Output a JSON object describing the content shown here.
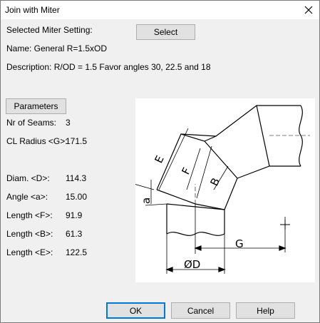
{
  "window": {
    "title": "Join with Miter"
  },
  "selected": {
    "label": "Selected Miter Setting:",
    "select_button": "Select",
    "name": "Name: General R=1.5xOD",
    "description": "Description: R/OD = 1.5 Favor angles 30, 22.5 and 18"
  },
  "parameters": {
    "button": "Parameters",
    "rows": [
      {
        "label": "Nr of Seams:",
        "value": "3"
      },
      {
        "label": "CL Radius <G>:",
        "value": "171.5"
      },
      {
        "label": "Diam. <D>:",
        "value": "114.3"
      },
      {
        "label": "Angle <a>:",
        "value": "15.00"
      },
      {
        "label": "Length <F>:",
        "value": "91.9"
      },
      {
        "label": "Length <B>:",
        "value": "61.3"
      },
      {
        "label": "Length <E>:",
        "value": "122.5"
      }
    ]
  },
  "diagram": {
    "labels": {
      "e": "E",
      "f": "F",
      "b": "B",
      "a": "a",
      "g": "G",
      "d": "ØD"
    }
  },
  "footer": {
    "ok": "OK",
    "cancel": "Cancel",
    "help": "Help"
  }
}
